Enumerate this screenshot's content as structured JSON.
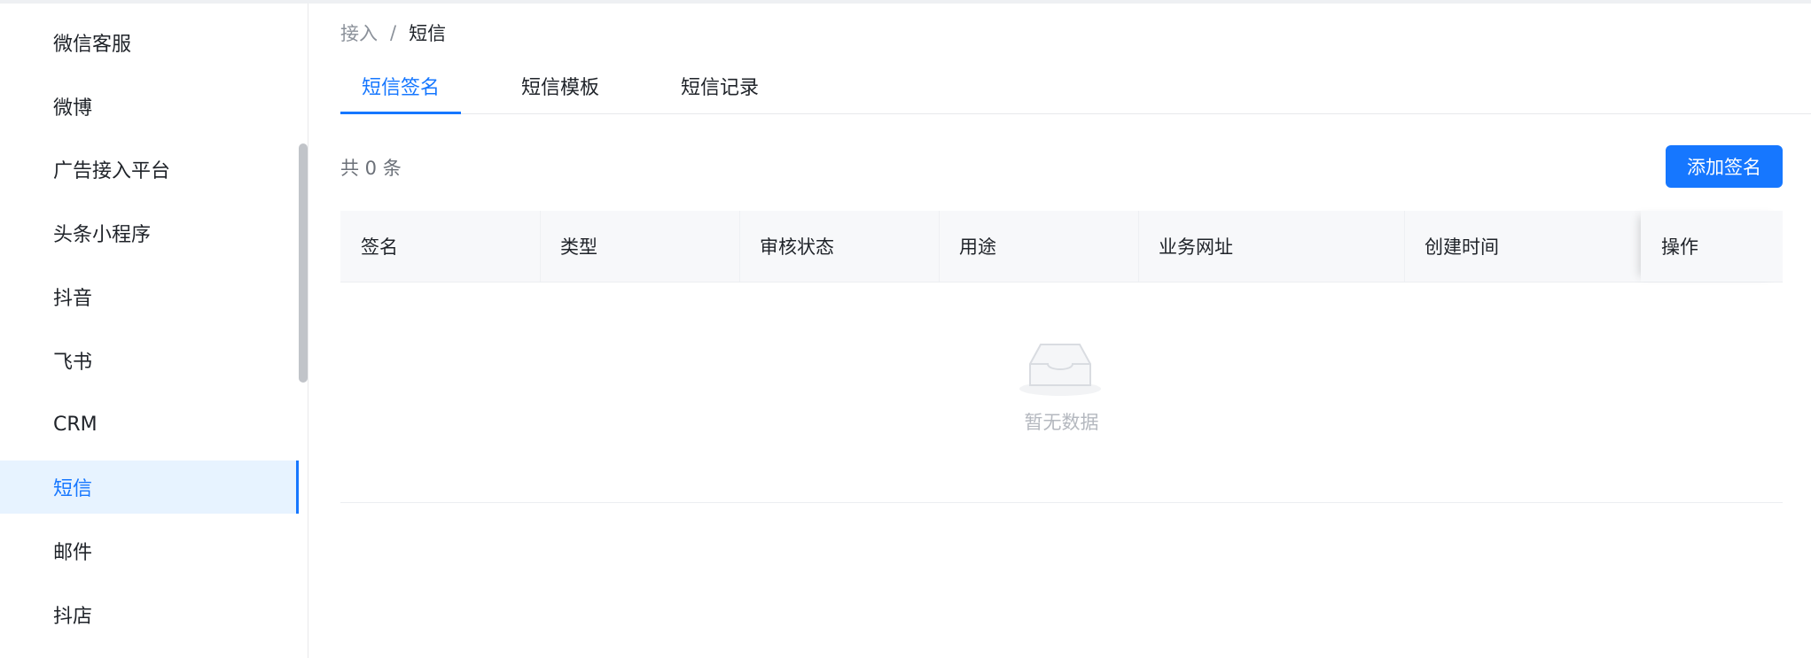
{
  "sidebar": {
    "items": [
      {
        "label": "微信客服"
      },
      {
        "label": "微博"
      },
      {
        "label": "广告接入平台"
      },
      {
        "label": "头条小程序"
      },
      {
        "label": "抖音"
      },
      {
        "label": "飞书"
      },
      {
        "label": "CRM"
      },
      {
        "label": "短信"
      },
      {
        "label": "邮件"
      },
      {
        "label": "抖店"
      }
    ],
    "active_index": 7
  },
  "breadcrumb": {
    "parent": "接入",
    "separator": "/",
    "current": "短信"
  },
  "tabs": [
    {
      "label": "短信签名"
    },
    {
      "label": "短信模板"
    },
    {
      "label": "短信记录"
    }
  ],
  "toolbar": {
    "count_text": "共 0 条",
    "add_button_label": "添加签名"
  },
  "table": {
    "columns": [
      "签名",
      "类型",
      "审核状态",
      "用途",
      "业务网址",
      "创建时间",
      "操作"
    ],
    "rows": [],
    "empty_text": "暂无数据"
  },
  "colors": {
    "accent": "#1677ff",
    "active_bg": "#e7f3ff"
  }
}
